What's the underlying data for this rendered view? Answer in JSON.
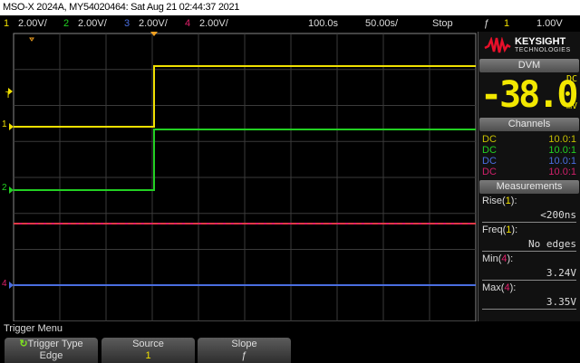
{
  "title": "MSO-X 2024A, MY54020464: Sat Aug 21 02:44:37 2021",
  "status": {
    "ch1": {
      "num": "1",
      "scale": "2.00V/"
    },
    "ch2": {
      "num": "2",
      "scale": "2.00V/"
    },
    "ch3": {
      "num": "3",
      "scale": "2.00V/"
    },
    "ch4": {
      "num": "4",
      "scale": "2.00V/"
    },
    "delay": "100.0s",
    "timebase": "50.00s/",
    "run_state": "Stop",
    "trigger_slope": "ƒ",
    "trigger_source": "1",
    "trigger_level": "1.00V"
  },
  "colors": {
    "ch1": "#f0e000",
    "ch2": "#22d022",
    "ch3": "#4a6ee0",
    "ch4": "#e0206a",
    "trigger": "#f0a020"
  },
  "markers": {
    "trigger": "T",
    "ch1": "1",
    "ch2": "2",
    "ch4": "4"
  },
  "panel": {
    "brand": "KEYSIGHT",
    "brand_sub": "TECHNOLOGIES",
    "dvm_header": "DVM",
    "dvm_value": "-38.0",
    "dvm_coupling": "DC",
    "dvm_unit": "mV",
    "channels_header": "Channels",
    "channels": [
      {
        "coupling": "DC",
        "probe": "10.0:1"
      },
      {
        "coupling": "DC",
        "probe": "10.0:1"
      },
      {
        "coupling": "DC",
        "probe": "10.0:1"
      },
      {
        "coupling": "DC",
        "probe": "10.0:1"
      }
    ],
    "measurements_header": "Measurements",
    "measurements": [
      {
        "name": "Rise(",
        "src": "1",
        "end": "):",
        "value": "<200ns"
      },
      {
        "name": "Freq(",
        "src": "1",
        "end": "):",
        "value": "No edges"
      },
      {
        "name": "Min(",
        "src": "4",
        "end": "):",
        "value": "3.24V"
      },
      {
        "name": "Max(",
        "src": "4",
        "end": "):",
        "value": "3.35V"
      }
    ]
  },
  "menu": {
    "title": "Trigger Menu",
    "softkeys": [
      {
        "label": "Trigger Type",
        "value": "Edge"
      },
      {
        "label": "Source",
        "value": "1"
      },
      {
        "label": "Slope",
        "value": "ƒ"
      }
    ]
  }
}
